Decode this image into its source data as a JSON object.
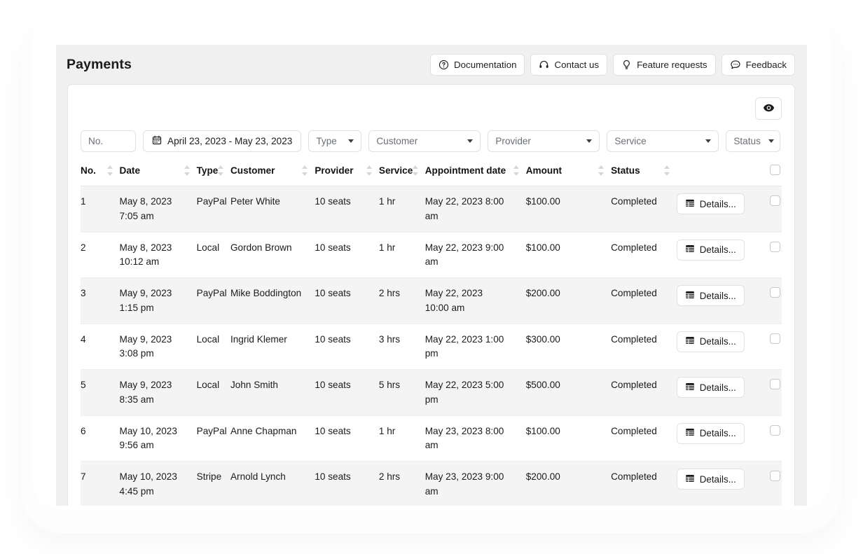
{
  "header": {
    "title": "Payments",
    "actions": [
      {
        "label": "Documentation",
        "icon": "question-circle-icon"
      },
      {
        "label": "Contact us",
        "icon": "headset-icon"
      },
      {
        "label": "Feature requests",
        "icon": "lightbulb-icon"
      },
      {
        "label": "Feedback",
        "icon": "chat-bubble-icon"
      }
    ]
  },
  "toolbar": {
    "preview_icon": "eye-icon"
  },
  "filters": {
    "number_placeholder": "No.",
    "number_value": "",
    "date_range": "April 23, 2023 - May 23, 2023",
    "date_icon": "calendar-icon",
    "type": "Type",
    "customer": "Customer",
    "provider": "Provider",
    "service": "Service",
    "status": "Status"
  },
  "table": {
    "columns": [
      {
        "label": "No.",
        "sortable": true
      },
      {
        "label": "Date",
        "sortable": true
      },
      {
        "label": "Type",
        "sortable": true
      },
      {
        "label": "Customer",
        "sortable": true
      },
      {
        "label": "Provider",
        "sortable": true
      },
      {
        "label": "Service",
        "sortable": true
      },
      {
        "label": "Appointment date",
        "sortable": true
      },
      {
        "label": "Amount",
        "sortable": true
      },
      {
        "label": "Status",
        "sortable": true
      }
    ],
    "details_label": "Details...",
    "details_icon": "table-icon",
    "rows": [
      {
        "no": "1",
        "date_day": "May 8, 2023",
        "date_time": "7:05 am",
        "type": "PayPal",
        "customer": "Peter White",
        "provider": "10 seats",
        "service": "1 hr",
        "appt_day": "May 22, 2023 8:00",
        "appt_time": "am",
        "amount": "$100.00",
        "status": "Completed"
      },
      {
        "no": "2",
        "date_day": "May 8, 2023",
        "date_time": "10:12 am",
        "type": "Local",
        "customer": "Gordon Brown",
        "provider": "10 seats",
        "service": "1 hr",
        "appt_day": "May 22, 2023 9:00",
        "appt_time": "am",
        "amount": "$100.00",
        "status": "Completed"
      },
      {
        "no": "3",
        "date_day": "May 9, 2023",
        "date_time": "1:15 pm",
        "type": "PayPal",
        "customer": "Mike Boddington",
        "provider": "10 seats",
        "service": "2 hrs",
        "appt_day": "May 22, 2023",
        "appt_time": "10:00 am",
        "amount": "$200.00",
        "status": "Completed"
      },
      {
        "no": "4",
        "date_day": "May 9, 2023",
        "date_time": "3:08 pm",
        "type": "Local",
        "customer": "Ingrid Klemer",
        "provider": "10 seats",
        "service": "3 hrs",
        "appt_day": "May 22, 2023 1:00",
        "appt_time": "pm",
        "amount": "$300.00",
        "status": "Completed"
      },
      {
        "no": "5",
        "date_day": "May 9, 2023",
        "date_time": "8:35 am",
        "type": "Local",
        "customer": "John Smith",
        "provider": "10 seats",
        "service": "5 hrs",
        "appt_day": "May 22, 2023 5:00",
        "appt_time": "pm",
        "amount": "$500.00",
        "status": "Completed"
      },
      {
        "no": "6",
        "date_day": "May 10, 2023",
        "date_time": "9:56 am",
        "type": "PayPal",
        "customer": "Anne Chapman",
        "provider": "10 seats",
        "service": "1 hr",
        "appt_day": "May 23, 2023 8:00",
        "appt_time": "am",
        "amount": "$100.00",
        "status": "Completed"
      },
      {
        "no": "7",
        "date_day": "May 10, 2023",
        "date_time": "4:45 pm",
        "type": "Stripe",
        "customer": "Arnold Lynch",
        "provider": "10 seats",
        "service": "2 hrs",
        "appt_day": "May 23, 2023 9:00",
        "appt_time": "am",
        "amount": "$200.00",
        "status": "Completed"
      }
    ]
  },
  "colors": {
    "window_bg": "#f0f0f0",
    "card_bg": "#ffffff",
    "row_alt_bg": "#f4f4f5",
    "border": "#dfe1e5",
    "text": "#1b1b1b",
    "muted_text": "#6b7076"
  }
}
